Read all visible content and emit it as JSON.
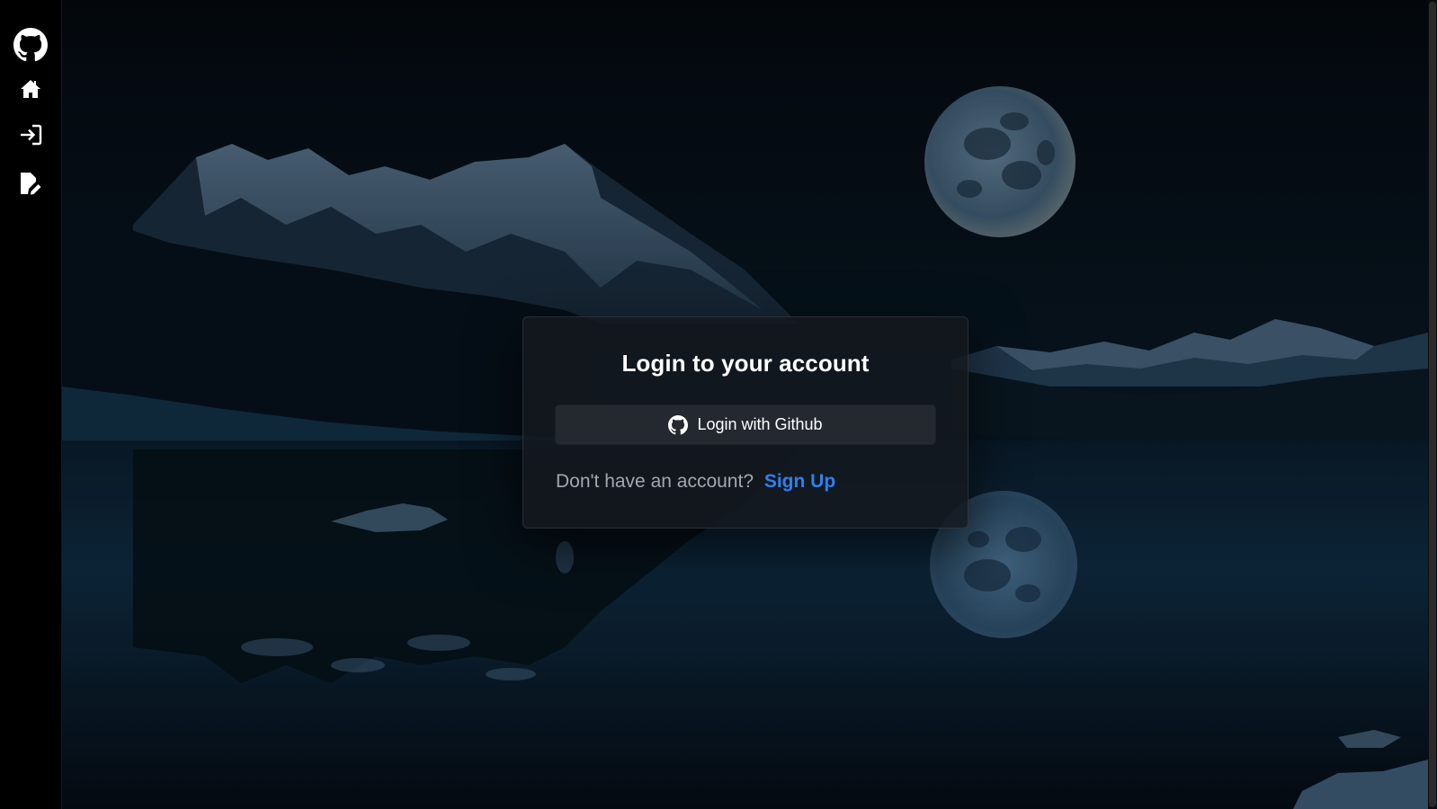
{
  "sidebar": {
    "items": [
      {
        "icon": "github-icon"
      },
      {
        "icon": "home-icon"
      },
      {
        "icon": "login-icon"
      },
      {
        "icon": "edit-document-icon"
      }
    ]
  },
  "login": {
    "title": "Login to your account",
    "github_button_label": "Login with Github",
    "github_button_icon": "github-icon",
    "signup_prompt": "Don't have an account?",
    "signup_link_label": "Sign Up"
  },
  "colors": {
    "accent": "#2f7ff0",
    "card_bg": "#14181e",
    "button_bg": "#24282f"
  }
}
